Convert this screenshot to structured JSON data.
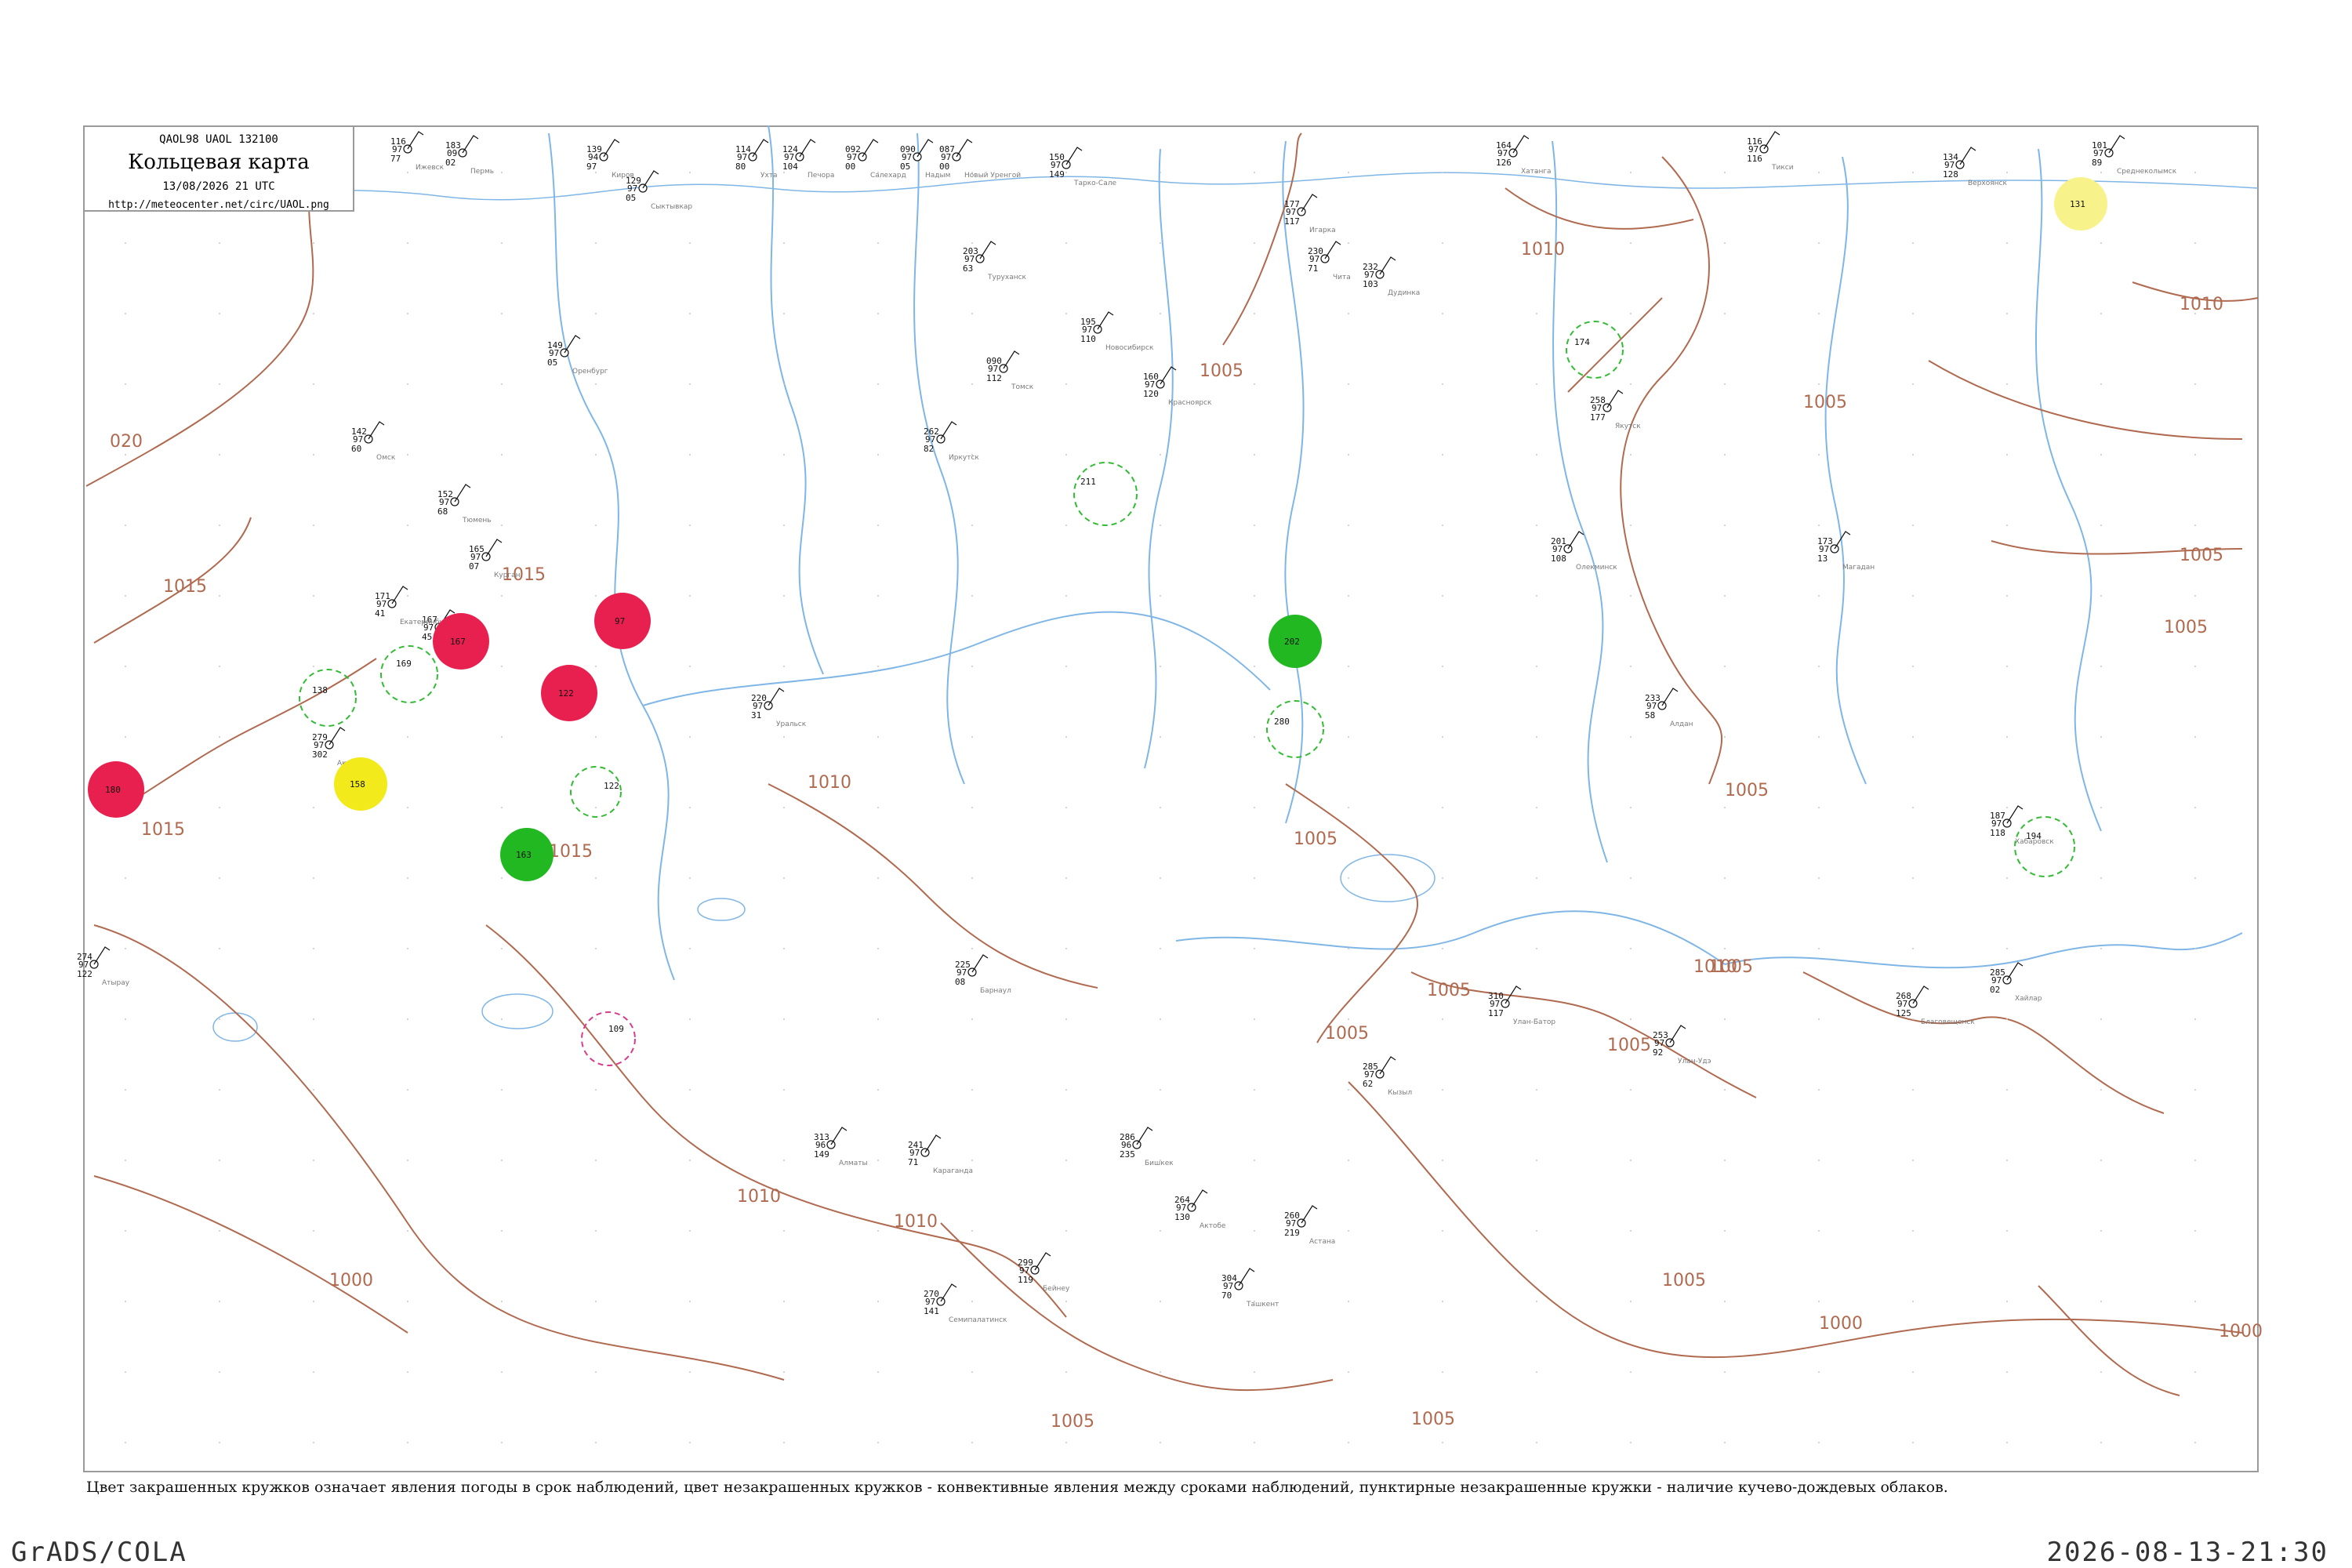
{
  "header": {
    "code_line": "QAOL98  UAOL  132100",
    "title": "Кольцевая карта",
    "datetime": "13/08/2026 21 UTC",
    "url": "http://meteocenter.net/circ/UAOL.png"
  },
  "caption": "Цвет закрашенных кружков означает явления погоды в срок наблюдений, цвет незакрашенных кружков - конвективные явления между сроками наблюдений, пунктирные незакрашенные кружки - наличие кучево-дождевых облаков.",
  "footer": {
    "left": "GrADS/COLA",
    "right": "2026-08-13-21:30"
  },
  "colors": {
    "isobar": "#b06a50",
    "river": "#7fb6e6",
    "red_marker": "#e8204f",
    "green_marker": "#22b822",
    "yellow_marker": "#f2ea1a",
    "dashed_green": "#33bb33"
  },
  "isobar_labels": [
    "020",
    "1015",
    "1015",
    "1015",
    "1015",
    "1010",
    "1010",
    "1010",
    "1010",
    "1010",
    "1010",
    "1005",
    "1005",
    "1005",
    "1005",
    "1005",
    "1005",
    "1005",
    "1005",
    "1005",
    "1005",
    "1005",
    "1005",
    "1005",
    "1000",
    "1000",
    "1000"
  ],
  "markers": [
    {
      "kind": "filled",
      "color": "red",
      "label": "167"
    },
    {
      "kind": "filled",
      "color": "red",
      "label": "97"
    },
    {
      "kind": "filled",
      "color": "red",
      "label": "122"
    },
    {
      "kind": "filled",
      "color": "red",
      "label": "180"
    },
    {
      "kind": "filled",
      "color": "green",
      "label": "202"
    },
    {
      "kind": "filled",
      "color": "green",
      "label": "163"
    },
    {
      "kind": "filled",
      "color": "yellow",
      "label": "158"
    },
    {
      "kind": "filled",
      "color": "yellow",
      "label": "131"
    },
    {
      "kind": "dashed",
      "color": "green",
      "label": "138"
    },
    {
      "kind": "dashed",
      "color": "green",
      "label": "169"
    },
    {
      "kind": "dashed",
      "color": "green",
      "label": "122"
    },
    {
      "kind": "dashed",
      "color": "green",
      "label": "174"
    },
    {
      "kind": "dashed",
      "color": "green",
      "label": "194"
    },
    {
      "kind": "dashed",
      "color": "green",
      "label": "211"
    },
    {
      "kind": "dashed",
      "color": "green",
      "label": "280"
    },
    {
      "kind": "dashed",
      "color": "red",
      "label": "109"
    }
  ],
  "stations": [
    {
      "name": "Ижевск",
      "a": "116",
      "b": "97",
      "c": "77"
    },
    {
      "name": "Пермь",
      "a": "183",
      "b": "09",
      "c": "02"
    },
    {
      "name": "Киров",
      "a": "139",
      "b": "94",
      "c": "97"
    },
    {
      "name": "Сыктывкар",
      "a": "129",
      "b": "97",
      "c": "05"
    },
    {
      "name": "Ухта",
      "a": "114",
      "b": "97",
      "c": "80"
    },
    {
      "name": "Печора",
      "a": "124",
      "b": "97",
      "c": "104"
    },
    {
      "name": "Салехард",
      "a": "092",
      "b": "97",
      "c": "00"
    },
    {
      "name": "Надым",
      "a": "090",
      "b": "97",
      "c": "05"
    },
    {
      "name": "Новый Уренгой",
      "a": "087",
      "b": "97",
      "c": "00"
    },
    {
      "name": "Тарко-Сале",
      "a": "150",
      "b": "97",
      "c": "149"
    },
    {
      "name": "Туруханск",
      "a": "203",
      "b": "97",
      "c": "63"
    },
    {
      "name": "Игарка",
      "a": "177",
      "b": "97",
      "c": "117"
    },
    {
      "name": "Дудинка",
      "a": "232",
      "b": "97",
      "c": "103"
    },
    {
      "name": "Хатанга",
      "a": "164",
      "b": "97",
      "c": "126"
    },
    {
      "name": "Тикси",
      "a": "116",
      "b": "97",
      "c": "116"
    },
    {
      "name": "Верхоянск",
      "a": "134",
      "b": "97",
      "c": "128"
    },
    {
      "name": "Среднеколымск",
      "a": "101",
      "b": "97",
      "c": "89"
    },
    {
      "name": "Уфа",
      "a": "167",
      "b": "97",
      "c": "45"
    },
    {
      "name": "Оренбург",
      "a": "149",
      "b": "97",
      "c": "05"
    },
    {
      "name": "Екатеринбург",
      "a": "171",
      "b": "97",
      "c": "41"
    },
    {
      "name": "Тюмень",
      "a": "152",
      "b": "97",
      "c": "68"
    },
    {
      "name": "Курган",
      "a": "165",
      "b": "97",
      "c": "07"
    },
    {
      "name": "Омск",
      "a": "142",
      "b": "97",
      "c": "60"
    },
    {
      "name": "Новосибирск",
      "a": "195",
      "b": "97",
      "c": "110"
    },
    {
      "name": "Томск",
      "a": "090",
      "b": "97",
      "c": "112"
    },
    {
      "name": "Красноярск",
      "a": "160",
      "b": "97",
      "c": "120"
    },
    {
      "name": "Иркутск",
      "a": "262",
      "b": "97",
      "c": "82"
    },
    {
      "name": "Чита",
      "a": "230",
      "b": "97",
      "c": "71"
    },
    {
      "name": "Якутск",
      "a": "258",
      "b": "97",
      "c": "177"
    },
    {
      "name": "Олекминск",
      "a": "201",
      "b": "97",
      "c": "108"
    },
    {
      "name": "Алдан",
      "a": "233",
      "b": "97",
      "c": "58"
    },
    {
      "name": "Магадан",
      "a": "173",
      "b": "97",
      "c": "13"
    },
    {
      "name": "Хабаровск",
      "a": "187",
      "b": "97",
      "c": "118"
    },
    {
      "name": "Благовещенск",
      "a": "268",
      "b": "97",
      "c": "125"
    },
    {
      "name": "Улан-Удэ",
      "a": "253",
      "b": "97",
      "c": "92"
    },
    {
      "name": "Кызыл",
      "a": "285",
      "b": "97",
      "c": "62"
    },
    {
      "name": "Барнаул",
      "a": "225",
      "b": "97",
      "c": "08"
    },
    {
      "name": "Семипалатинск",
      "a": "270",
      "b": "97",
      "c": "141"
    },
    {
      "name": "Караганда",
      "a": "241",
      "b": "97",
      "c": "71"
    },
    {
      "name": "Астана",
      "a": "260",
      "b": "97",
      "c": "219"
    },
    {
      "name": "Актобе",
      "a": "264",
      "b": "97",
      "c": "130"
    },
    {
      "name": "Уральск",
      "a": "220",
      "b": "97",
      "c": "31"
    },
    {
      "name": "Актау",
      "a": "279",
      "b": "97",
      "c": "302"
    },
    {
      "name": "Атырау",
      "a": "274",
      "b": "97",
      "c": "122"
    },
    {
      "name": "Бейнеу",
      "a": "299",
      "b": "97",
      "c": "119"
    },
    {
      "name": "Ташкент",
      "a": "304",
      "b": "97",
      "c": "70"
    },
    {
      "name": "Алматы",
      "a": "313",
      "b": "96",
      "c": "149"
    },
    {
      "name": "Бишкек",
      "a": "286",
      "b": "96",
      "c": "235"
    },
    {
      "name": "Улан-Батор",
      "a": "310",
      "b": "97",
      "c": "117"
    },
    {
      "name": "Хайлар",
      "a": "285",
      "b": "97",
      "c": "02"
    }
  ]
}
